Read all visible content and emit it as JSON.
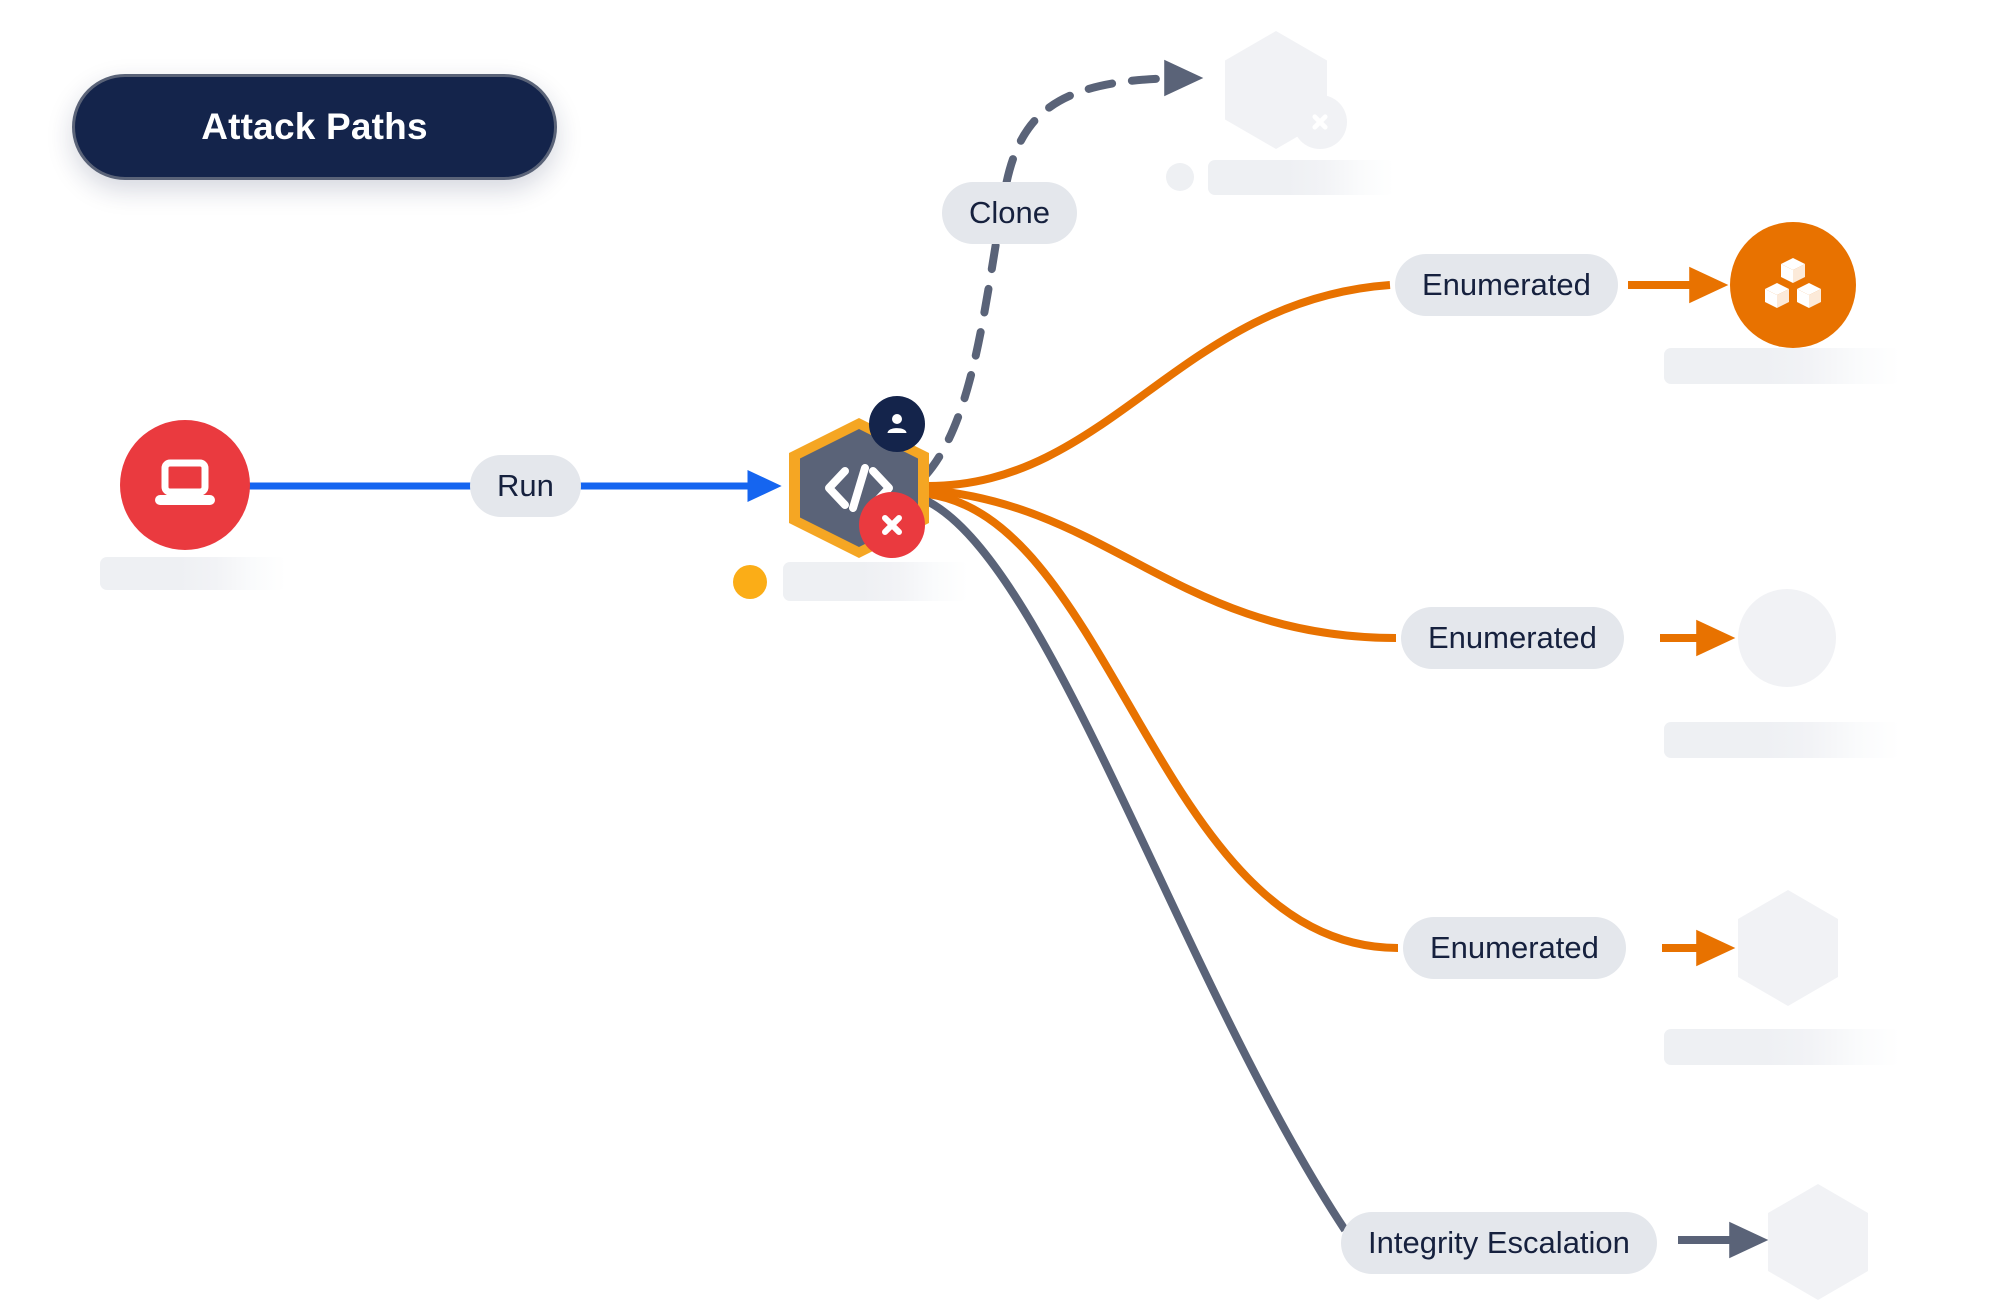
{
  "title_badge": {
    "label": "Attack Paths"
  },
  "colors": {
    "navy": "#14244b",
    "orange": "#e87200",
    "amber": "#f5a623",
    "amber_dot": "#fbad17",
    "red": "#ea3a3f",
    "blue": "#1565f0",
    "slate": "#5a6378",
    "hex_fill": "#5a6378",
    "pill_bg": "#e4e7ec",
    "pill_text": "#16213e",
    "ghost": "#f1f2f5",
    "canvas": "#ffffff"
  },
  "nodes": [
    {
      "id": "source-host",
      "kind": "circle",
      "shape": "circle",
      "icon": "laptop-icon",
      "color": "#ea3a3f",
      "state": "active",
      "has_placeholder_label": true
    },
    {
      "id": "code-process",
      "kind": "hexagon",
      "shape": "hexagon",
      "icon": "code-icon",
      "color": "#5a6378",
      "border_color": "#f5a623",
      "state": "active",
      "badges": [
        "user-icon",
        "error-x-icon"
      ],
      "status_dot": "#fbad17",
      "has_placeholder_label": true
    },
    {
      "id": "cloned-target",
      "kind": "hexagon",
      "shape": "hexagon",
      "icon": "",
      "color": "#f1f2f5",
      "state": "ghost",
      "badges": [
        "error-x-icon"
      ],
      "has_placeholder_label": true
    },
    {
      "id": "bucket-store",
      "kind": "circle",
      "shape": "circle",
      "icon": "cubes-icon",
      "color": "#e87200",
      "state": "active",
      "has_placeholder_label": true
    },
    {
      "id": "enumerated-circle-target",
      "kind": "circle",
      "shape": "circle",
      "icon": "",
      "color": "#f1f2f5",
      "state": "ghost",
      "has_placeholder_label": true
    },
    {
      "id": "enumerated-hex-target",
      "kind": "hexagon",
      "shape": "hexagon",
      "icon": "",
      "color": "#f1f2f5",
      "state": "ghost",
      "has_placeholder_label": true
    },
    {
      "id": "escalation-target",
      "kind": "hexagon",
      "shape": "hexagon",
      "icon": "",
      "color": "#f1f2f5",
      "state": "ghost",
      "has_placeholder_label": false
    }
  ],
  "edges": [
    {
      "id": "run-edge",
      "label": "Run",
      "style": "solid",
      "color": "#1565f0",
      "from": "source-host",
      "to": "code-process"
    },
    {
      "id": "clone-edge",
      "label": "Clone",
      "style": "dashed",
      "color": "#5a6378",
      "from": "code-process",
      "to": "cloned-target"
    },
    {
      "id": "enumerated-1",
      "label": "Enumerated",
      "style": "solid",
      "color": "#e87200",
      "from": "code-process",
      "to": "bucket-store"
    },
    {
      "id": "enumerated-2",
      "label": "Enumerated",
      "style": "solid",
      "color": "#e87200",
      "from": "code-process",
      "to": "enumerated-circle-target"
    },
    {
      "id": "enumerated-3",
      "label": "Enumerated",
      "style": "solid",
      "color": "#e87200",
      "from": "code-process",
      "to": "enumerated-hex-target"
    },
    {
      "id": "escalation-edge",
      "label": "Integrity Escalation",
      "style": "solid",
      "color": "#5a6378",
      "from": "code-process",
      "to": "escalation-target"
    }
  ],
  "labels": {
    "run": "Run",
    "clone": "Clone",
    "enumerated_1": "Enumerated",
    "enumerated_2": "Enumerated",
    "enumerated_3": "Enumerated",
    "integrity_escalation": "Integrity Escalation"
  }
}
